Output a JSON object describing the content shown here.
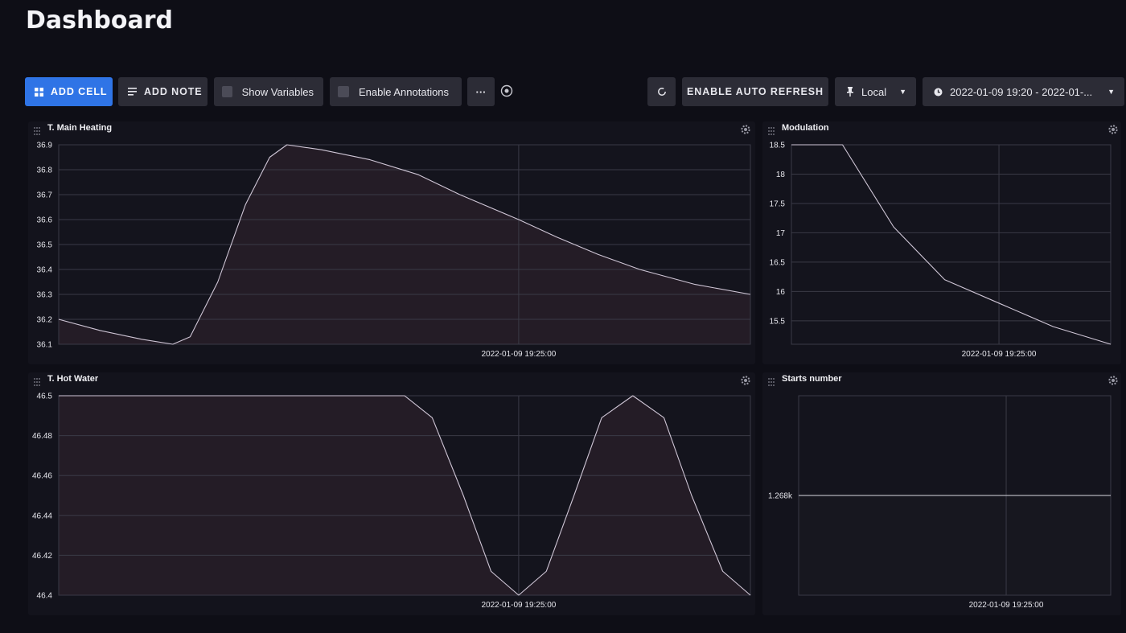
{
  "page": {
    "title": "Dashboard"
  },
  "toolbar": {
    "add_cell": "ADD CELL",
    "add_note": "ADD NOTE",
    "show_variables": "Show Variables",
    "enable_annotations": "Enable Annotations",
    "more": "···",
    "auto_refresh": "ENABLE AUTO REFRESH",
    "timezone": "Local",
    "time_range": "2022-01-09 19:20 - 2022-01-..."
  },
  "colors": {
    "accent": "#2f74e6",
    "line": "#cfc6d6",
    "area": "#241c26",
    "grid": "#3a3a46"
  },
  "chart_data": [
    {
      "id": "main-heating",
      "type": "area",
      "title": "T. Main Heating",
      "xlabel": "",
      "ylabel": "",
      "x_tick_label": "2022-01-09 19:25:00",
      "x_range": [
        0,
        1
      ],
      "x_tick_pos": 0.665,
      "ylim": [
        36.1,
        36.9
      ],
      "yticks": [
        "36.9",
        "36.8",
        "36.7",
        "36.6",
        "36.5",
        "36.4",
        "36.3",
        "36.2",
        "36.1"
      ],
      "ytick_values": [
        36.9,
        36.8,
        36.7,
        36.6,
        36.5,
        36.4,
        36.3,
        36.2,
        36.1
      ],
      "grid": true,
      "points": [
        [
          0,
          36.2
        ],
        [
          0.06,
          36.155
        ],
        [
          0.12,
          36.12
        ],
        [
          0.165,
          36.1
        ],
        [
          0.19,
          36.13
        ],
        [
          0.23,
          36.35
        ],
        [
          0.27,
          36.66
        ],
        [
          0.305,
          36.85
        ],
        [
          0.33,
          36.9
        ],
        [
          0.38,
          36.88
        ],
        [
          0.45,
          36.84
        ],
        [
          0.52,
          36.78
        ],
        [
          0.58,
          36.7
        ],
        [
          0.665,
          36.6
        ],
        [
          0.72,
          36.53
        ],
        [
          0.78,
          36.46
        ],
        [
          0.84,
          36.4
        ],
        [
          0.92,
          36.34
        ],
        [
          1,
          36.3
        ]
      ]
    },
    {
      "id": "modulation",
      "type": "line",
      "title": "Modulation",
      "xlabel": "",
      "ylabel": "",
      "x_tick_label": "2022-01-09 19:25:00",
      "x_range": [
        0,
        1
      ],
      "x_tick_pos": 0.65,
      "ylim": [
        15.1,
        18.5
      ],
      "yticks": [
        "18.5",
        "18",
        "17.5",
        "17",
        "16.5",
        "16",
        "15.5"
      ],
      "ytick_values": [
        18.5,
        18,
        17.5,
        17,
        16.5,
        16,
        15.5
      ],
      "grid": true,
      "points": [
        [
          0,
          18.5
        ],
        [
          0.16,
          18.5
        ],
        [
          0.32,
          17.1
        ],
        [
          0.48,
          16.2
        ],
        [
          0.65,
          15.8
        ],
        [
          0.82,
          15.4
        ],
        [
          1,
          15.1
        ]
      ]
    },
    {
      "id": "hot-water",
      "type": "area",
      "title": "T. Hot Water",
      "xlabel": "",
      "ylabel": "",
      "x_tick_label": "2022-01-09 19:25:00",
      "x_range": [
        0,
        1
      ],
      "x_tick_pos": 0.665,
      "ylim": [
        46.4,
        46.5
      ],
      "yticks": [
        "46.5",
        "46.48",
        "46.46",
        "46.44",
        "46.42",
        "46.4"
      ],
      "ytick_values": [
        46.5,
        46.48,
        46.46,
        46.44,
        46.42,
        46.4
      ],
      "grid": true,
      "points": [
        [
          0,
          46.5
        ],
        [
          0.5,
          46.5
        ],
        [
          0.54,
          46.489
        ],
        [
          0.585,
          46.45
        ],
        [
          0.625,
          46.412
        ],
        [
          0.665,
          46.4
        ],
        [
          0.705,
          46.412
        ],
        [
          0.745,
          46.45
        ],
        [
          0.785,
          46.489
        ],
        [
          0.83,
          46.5
        ],
        [
          0.875,
          46.489
        ],
        [
          0.915,
          46.45
        ],
        [
          0.96,
          46.412
        ],
        [
          1,
          46.4
        ]
      ]
    },
    {
      "id": "starts-number",
      "type": "line",
      "title": "Starts number",
      "xlabel": "",
      "ylabel": "",
      "x_tick_label": "2022-01-09 19:25:00",
      "x_range": [
        0,
        1
      ],
      "x_tick_pos": 0.665,
      "ylim": [
        0,
        1
      ],
      "yticks": [
        "1.268k"
      ],
      "ytick_values": [
        0.5
      ],
      "grid": true,
      "points": [
        [
          0,
          0.5
        ],
        [
          1,
          0.5
        ]
      ]
    }
  ]
}
